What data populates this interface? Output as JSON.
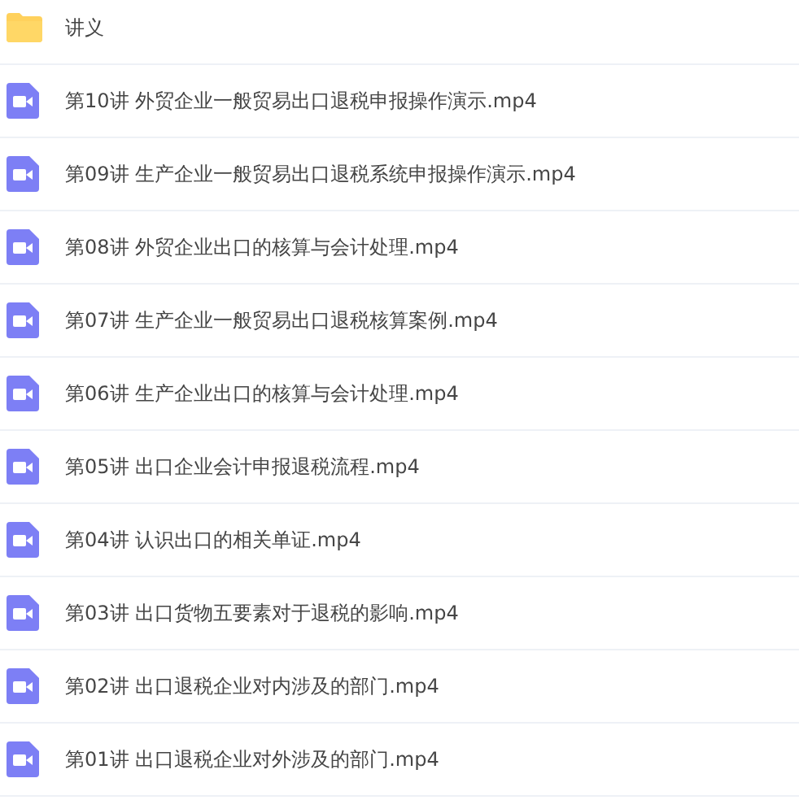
{
  "files": [
    {
      "kind": "folder",
      "name": "讲义"
    },
    {
      "kind": "video",
      "name": "第10讲 外贸企业一般贸易出口退税申报操作演示.mp4"
    },
    {
      "kind": "video",
      "name": "第09讲 生产企业一般贸易出口退税系统申报操作演示.mp4"
    },
    {
      "kind": "video",
      "name": "第08讲 外贸企业出口的核算与会计处理.mp4"
    },
    {
      "kind": "video",
      "name": "第07讲 生产企业一般贸易出口退税核算案例.mp4"
    },
    {
      "kind": "video",
      "name": "第06讲 生产企业出口的核算与会计处理.mp4"
    },
    {
      "kind": "video",
      "name": "第05讲 出口企业会计申报退税流程.mp4"
    },
    {
      "kind": "video",
      "name": "第04讲 认识出口的相关单证.mp4"
    },
    {
      "kind": "video",
      "name": "第03讲 出口货物五要素对于退税的影响.mp4"
    },
    {
      "kind": "video",
      "name": "第02讲 出口退税企业对内涉及的部门.mp4"
    },
    {
      "kind": "video",
      "name": "第01讲 出口退税企业对外涉及的部门.mp4"
    }
  ]
}
